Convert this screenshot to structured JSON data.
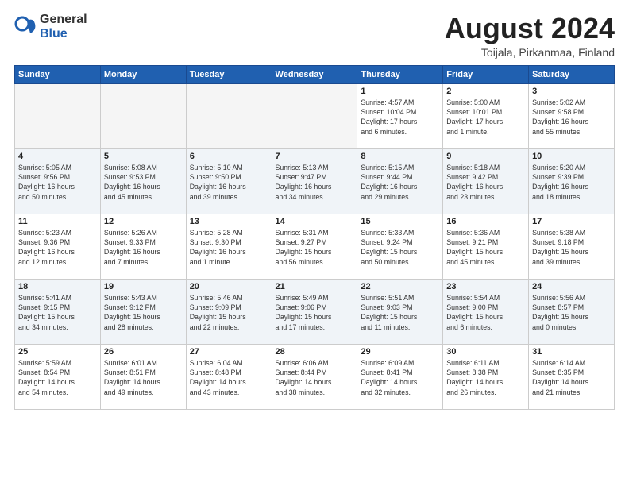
{
  "logo": {
    "general": "General",
    "blue": "Blue"
  },
  "header": {
    "month": "August 2024",
    "location": "Toijala, Pirkanmaa, Finland"
  },
  "weekdays": [
    "Sunday",
    "Monday",
    "Tuesday",
    "Wednesday",
    "Thursday",
    "Friday",
    "Saturday"
  ],
  "weeks": [
    [
      {
        "day": "",
        "empty": true
      },
      {
        "day": "",
        "empty": true
      },
      {
        "day": "",
        "empty": true
      },
      {
        "day": "",
        "empty": true
      },
      {
        "day": "1",
        "info": "Sunrise: 4:57 AM\nSunset: 10:04 PM\nDaylight: 17 hours\nand 6 minutes."
      },
      {
        "day": "2",
        "info": "Sunrise: 5:00 AM\nSunset: 10:01 PM\nDaylight: 17 hours\nand 1 minute."
      },
      {
        "day": "3",
        "info": "Sunrise: 5:02 AM\nSunset: 9:58 PM\nDaylight: 16 hours\nand 55 minutes."
      }
    ],
    [
      {
        "day": "4",
        "info": "Sunrise: 5:05 AM\nSunset: 9:56 PM\nDaylight: 16 hours\nand 50 minutes."
      },
      {
        "day": "5",
        "info": "Sunrise: 5:08 AM\nSunset: 9:53 PM\nDaylight: 16 hours\nand 45 minutes."
      },
      {
        "day": "6",
        "info": "Sunrise: 5:10 AM\nSunset: 9:50 PM\nDaylight: 16 hours\nand 39 minutes."
      },
      {
        "day": "7",
        "info": "Sunrise: 5:13 AM\nSunset: 9:47 PM\nDaylight: 16 hours\nand 34 minutes."
      },
      {
        "day": "8",
        "info": "Sunrise: 5:15 AM\nSunset: 9:44 PM\nDaylight: 16 hours\nand 29 minutes."
      },
      {
        "day": "9",
        "info": "Sunrise: 5:18 AM\nSunset: 9:42 PM\nDaylight: 16 hours\nand 23 minutes."
      },
      {
        "day": "10",
        "info": "Sunrise: 5:20 AM\nSunset: 9:39 PM\nDaylight: 16 hours\nand 18 minutes."
      }
    ],
    [
      {
        "day": "11",
        "info": "Sunrise: 5:23 AM\nSunset: 9:36 PM\nDaylight: 16 hours\nand 12 minutes."
      },
      {
        "day": "12",
        "info": "Sunrise: 5:26 AM\nSunset: 9:33 PM\nDaylight: 16 hours\nand 7 minutes."
      },
      {
        "day": "13",
        "info": "Sunrise: 5:28 AM\nSunset: 9:30 PM\nDaylight: 16 hours\nand 1 minute."
      },
      {
        "day": "14",
        "info": "Sunrise: 5:31 AM\nSunset: 9:27 PM\nDaylight: 15 hours\nand 56 minutes."
      },
      {
        "day": "15",
        "info": "Sunrise: 5:33 AM\nSunset: 9:24 PM\nDaylight: 15 hours\nand 50 minutes."
      },
      {
        "day": "16",
        "info": "Sunrise: 5:36 AM\nSunset: 9:21 PM\nDaylight: 15 hours\nand 45 minutes."
      },
      {
        "day": "17",
        "info": "Sunrise: 5:38 AM\nSunset: 9:18 PM\nDaylight: 15 hours\nand 39 minutes."
      }
    ],
    [
      {
        "day": "18",
        "info": "Sunrise: 5:41 AM\nSunset: 9:15 PM\nDaylight: 15 hours\nand 34 minutes."
      },
      {
        "day": "19",
        "info": "Sunrise: 5:43 AM\nSunset: 9:12 PM\nDaylight: 15 hours\nand 28 minutes."
      },
      {
        "day": "20",
        "info": "Sunrise: 5:46 AM\nSunset: 9:09 PM\nDaylight: 15 hours\nand 22 minutes."
      },
      {
        "day": "21",
        "info": "Sunrise: 5:49 AM\nSunset: 9:06 PM\nDaylight: 15 hours\nand 17 minutes."
      },
      {
        "day": "22",
        "info": "Sunrise: 5:51 AM\nSunset: 9:03 PM\nDaylight: 15 hours\nand 11 minutes."
      },
      {
        "day": "23",
        "info": "Sunrise: 5:54 AM\nSunset: 9:00 PM\nDaylight: 15 hours\nand 6 minutes."
      },
      {
        "day": "24",
        "info": "Sunrise: 5:56 AM\nSunset: 8:57 PM\nDaylight: 15 hours\nand 0 minutes."
      }
    ],
    [
      {
        "day": "25",
        "info": "Sunrise: 5:59 AM\nSunset: 8:54 PM\nDaylight: 14 hours\nand 54 minutes."
      },
      {
        "day": "26",
        "info": "Sunrise: 6:01 AM\nSunset: 8:51 PM\nDaylight: 14 hours\nand 49 minutes."
      },
      {
        "day": "27",
        "info": "Sunrise: 6:04 AM\nSunset: 8:48 PM\nDaylight: 14 hours\nand 43 minutes."
      },
      {
        "day": "28",
        "info": "Sunrise: 6:06 AM\nSunset: 8:44 PM\nDaylight: 14 hours\nand 38 minutes."
      },
      {
        "day": "29",
        "info": "Sunrise: 6:09 AM\nSunset: 8:41 PM\nDaylight: 14 hours\nand 32 minutes."
      },
      {
        "day": "30",
        "info": "Sunrise: 6:11 AM\nSunset: 8:38 PM\nDaylight: 14 hours\nand 26 minutes."
      },
      {
        "day": "31",
        "info": "Sunrise: 6:14 AM\nSunset: 8:35 PM\nDaylight: 14 hours\nand 21 minutes."
      }
    ]
  ]
}
